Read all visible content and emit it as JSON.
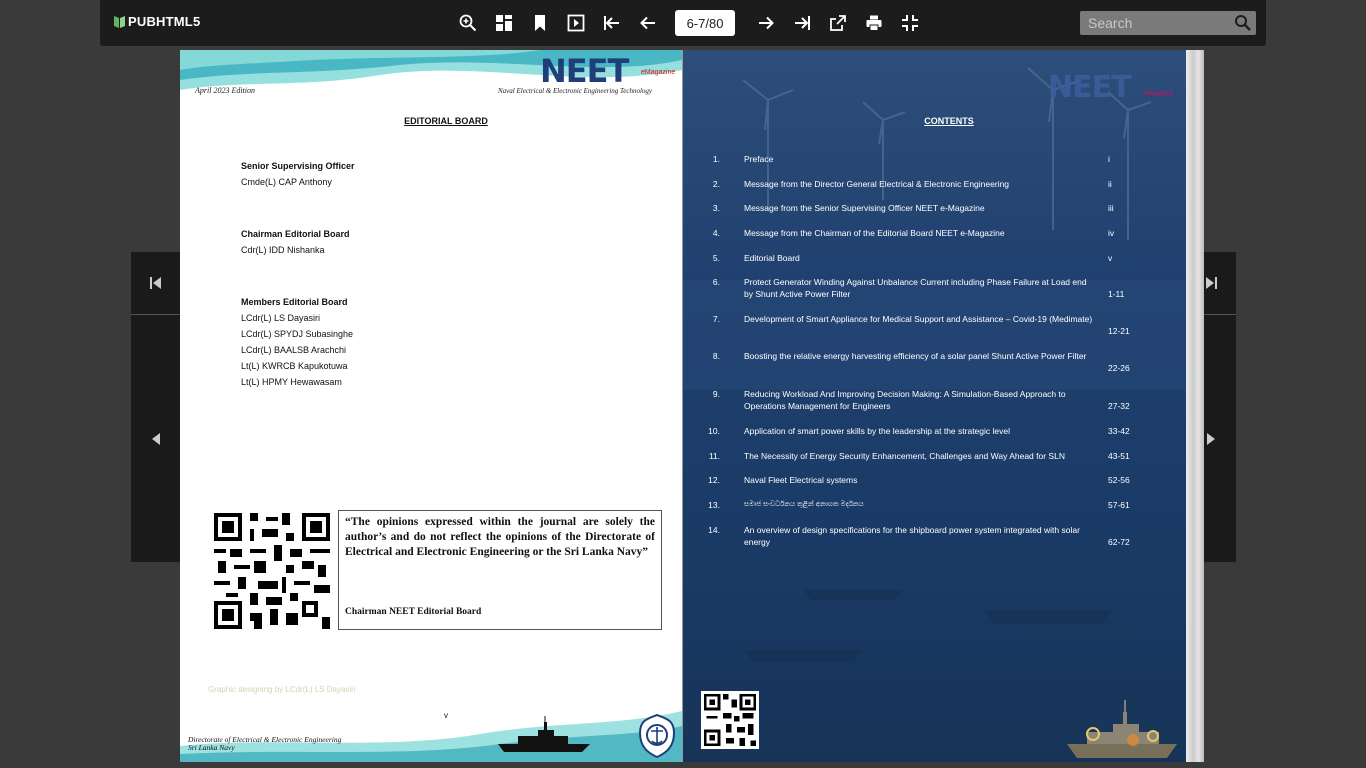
{
  "app": {
    "logo": "PUBHTML5"
  },
  "toolbar": {
    "page_indicator": "6-7/80",
    "search_placeholder": "Search",
    "icons": [
      "zoom-in-icon",
      "thumbnails-icon",
      "bookmark-icon",
      "single-page-icon",
      "first-page-icon",
      "previous-page-icon",
      "next-page-icon",
      "last-page-icon",
      "share-icon",
      "print-icon",
      "fullscreen-icon",
      "search-icon"
    ]
  },
  "left_page": {
    "edition": "April 2023 Edition",
    "brand": "NEET",
    "brand_sub": "eMagazine",
    "tagline": "Naval Electrical & Electronic Engineering Technology",
    "title": "EDITORIAL BOARD",
    "sections": [
      {
        "heading": "Senior Supervising Officer",
        "members": [
          "Cmde(L) CAP Anthony"
        ]
      },
      {
        "heading": "Chairman Editorial Board",
        "members": [
          "Cdr(L) IDD Nishanka"
        ]
      },
      {
        "heading": "Members Editorial Board",
        "members": [
          "LCdr(L) LS Dayasiri",
          "LCdr(L) SPYDJ Subasinghe",
          "LCdr(L) BAALSB Arachchi",
          "Lt(L) KWRCB Kapukotuwa",
          "Lt(L) HPMY Hewawasam"
        ]
      }
    ],
    "quote": "“The opinions expressed within the journal are solely the author’s and do not reflect the opinions of the Directorate of Electrical and Electronic Engineering or the Sri Lanka Navy”",
    "quote_signature": "Chairman NEET Editorial Board",
    "design_credit": "Graphic designing by LCdr(L) LS Dayasiri",
    "page_number": "v",
    "footer_line1": "Directorate of Electrical & Electronic Engineering",
    "footer_line2": "Sri Lanka Navy"
  },
  "right_page": {
    "brand": "NEET",
    "brand_sub": "eMagazine",
    "title": "CONTENTS",
    "toc": [
      {
        "num": "1.",
        "title": "Preface",
        "page": "i"
      },
      {
        "num": "2.",
        "title": "Message from the Director General Electrical & Electronic Engineering",
        "page": "ii"
      },
      {
        "num": "3.",
        "title": "Message from the Senior Supervising Officer NEET e-Magazine",
        "page": "iii"
      },
      {
        "num": "4.",
        "title": "Message from the Chairman of the Editorial Board NEET e-Magazine",
        "page": "iv"
      },
      {
        "num": "5.",
        "title": "Editorial Board",
        "page": "v"
      },
      {
        "num": "6.",
        "title": "Protect Generator Winding Against Unbalance Current including Phase Failure at Load end by Shunt Active Power Filter",
        "page": "1-11"
      },
      {
        "num": "7.",
        "title": "Development of Smart Appliance for Medical Support and Assistance – Covid-19 (Medimate)",
        "page": "12-21"
      },
      {
        "num": "8.",
        "title": "Boosting the relative energy harvesting efficiency of a solar panel Shunt Active Power Filter",
        "page": "22-26"
      },
      {
        "num": "9.",
        "title": "Reducing Workload And Improving Decision Making: A Simulation-Based Approach to Operations Management for Engineers",
        "page": "27-32"
      },
      {
        "num": "10.",
        "title": "Application of smart power skills by the leadership at the strategic level",
        "page": "33-42"
      },
      {
        "num": "11.",
        "title": "The Necessity of Energy Security Enhancement, Challenges and Way Ahead for SLN",
        "page": "43-51"
      },
      {
        "num": "12.",
        "title": "Naval Fleet Electrical systems",
        "page": "52-56"
      },
      {
        "num": "13.",
        "title": "සමාජ සංවර්ධනය තුළින් අනාගත මර්දනය",
        "page": "57-61"
      },
      {
        "num": "14.",
        "title": "An overview of design specifications for the shipboard power system integrated with solar energy",
        "page": "62-72"
      }
    ]
  },
  "colors": {
    "toolbar": "#1c1c1c",
    "background": "#3a3a3a",
    "brand_blue": "#1f3f7a",
    "logo_green": "#5cb85c"
  }
}
